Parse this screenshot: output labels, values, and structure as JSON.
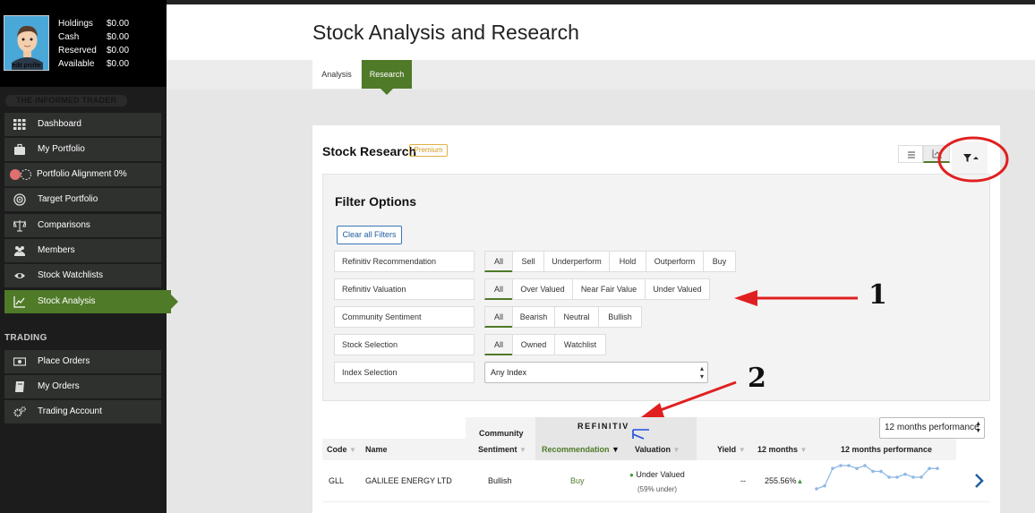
{
  "account": {
    "edit_profile": "edit profile",
    "rows": [
      {
        "label": "Holdings",
        "value": "$0.00"
      },
      {
        "label": "Cash",
        "value": "$0.00"
      },
      {
        "label": "Reserved",
        "value": "$0.00"
      },
      {
        "label": "Available",
        "value": "$0.00"
      }
    ]
  },
  "brand": "THE INFORMED TRADER",
  "sidebar": {
    "items": [
      {
        "label": "Dashboard",
        "icon": "grid-icon"
      },
      {
        "label": "My Portfolio",
        "icon": "briefcase-icon"
      },
      {
        "label": "Portfolio Alignment 0%",
        "icon": "alignment-dots-icon"
      },
      {
        "label": "Target Portfolio",
        "icon": "target-icon"
      },
      {
        "label": "Comparisons",
        "icon": "scale-icon"
      },
      {
        "label": "Members",
        "icon": "users-icon"
      },
      {
        "label": "Stock Watchlists",
        "icon": "eye-icon"
      },
      {
        "label": "Stock Analysis",
        "icon": "line-chart-icon",
        "active": true
      }
    ],
    "trading_header": "TRADING",
    "trading_items": [
      {
        "label": "Place Orders",
        "icon": "cash-icon"
      },
      {
        "label": "My Orders",
        "icon": "book-icon"
      },
      {
        "label": "Trading Account",
        "icon": "gears-icon"
      }
    ]
  },
  "page": {
    "title": "Stock Analysis and Research",
    "tabs": [
      {
        "label": "Analysis"
      },
      {
        "label": "Research",
        "active": true
      }
    ]
  },
  "research": {
    "title": "Stock Research",
    "badge": "Premium",
    "filter_title": "Filter Options",
    "clear_label": "Clear all Filters",
    "filters": [
      {
        "label": "Refinitiv Recommendation",
        "options": [
          "All",
          "Sell",
          "Underperform",
          "Hold",
          "Outperform",
          "Buy"
        ],
        "selected": "All"
      },
      {
        "label": "Refinitiv Valuation",
        "options": [
          "All",
          "Over Valued",
          "Near Fair Value",
          "Under Valued"
        ],
        "selected": "All"
      },
      {
        "label": "Community Sentiment",
        "options": [
          "All",
          "Bearish",
          "Neutral",
          "Bullish"
        ],
        "selected": "All"
      },
      {
        "label": "Stock Selection",
        "options": [
          "All",
          "Owned",
          "Watchlist"
        ],
        "selected": "All"
      }
    ],
    "index_filter": {
      "label": "Index Selection",
      "value": "Any Index"
    }
  },
  "table": {
    "refinitiv_logo": "REFINITIV",
    "community_header": "Community",
    "perf_select": "12 months performance",
    "columns": {
      "code": "Code",
      "name": "Name",
      "sentiment": "Sentiment",
      "recommendation": "Recommendation",
      "valuation": "Valuation",
      "yield": "Yield",
      "twelve_months": "12 months",
      "perf": "12 months performance"
    },
    "rows": [
      {
        "code": "GLL",
        "name": "GALILEE ENERGY LTD",
        "sentiment": "Bullish",
        "recommendation": "Buy",
        "valuation": "Under Valued",
        "valuation_sub": "(59% under)",
        "yield": "--",
        "change": "255.56%",
        "sparkline": [
          2,
          3,
          9,
          10,
          10,
          9,
          10,
          8,
          8,
          6,
          6,
          7,
          6,
          6,
          9,
          9
        ]
      }
    ]
  },
  "annotations": {
    "one": "1",
    "two": "2"
  },
  "colors": {
    "accent": "#4f7a28",
    "link": "#2060a0",
    "premium": "#d49a1c",
    "annotation_red": "#e02020"
  }
}
